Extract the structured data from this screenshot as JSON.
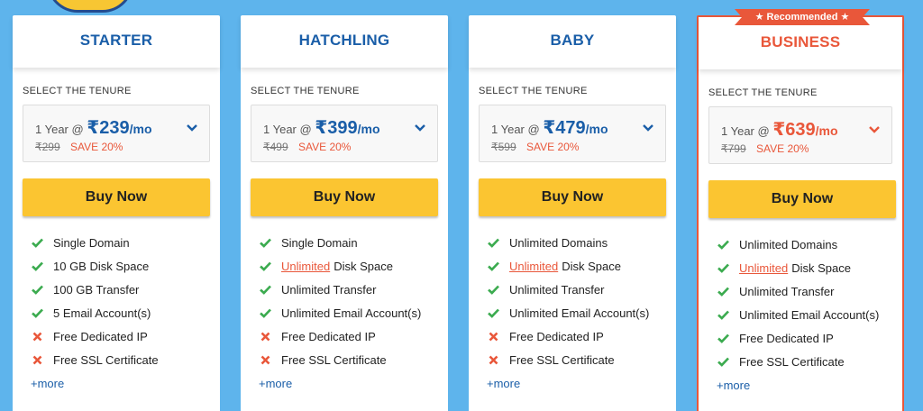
{
  "colors": {
    "background": "#5eb4ec",
    "brand_blue": "#1a5ea8",
    "accent_orange": "#e9573a",
    "button_yellow": "#fbc531",
    "check_green": "#3bab4f"
  },
  "recommended_label": "★ Recommended ★",
  "plans": [
    {
      "name": "STARTER",
      "tenure_label": "SELECT THE TENURE",
      "duration": "1 Year @",
      "price": "₹239",
      "per": "/mo",
      "old_price": "₹299",
      "save": "SAVE 20%",
      "button": "Buy Now",
      "features": [
        {
          "icon": "check-icon",
          "highlight": "",
          "text": "Single Domain"
        },
        {
          "icon": "check-icon",
          "highlight": "",
          "text": "10 GB Disk Space"
        },
        {
          "icon": "check-icon",
          "highlight": "",
          "text": "100 GB Transfer"
        },
        {
          "icon": "check-icon",
          "highlight": "",
          "text": "5 Email Account(s)"
        },
        {
          "icon": "cross-icon",
          "highlight": "",
          "text": "Free Dedicated IP"
        },
        {
          "icon": "cross-icon",
          "highlight": "",
          "text": "Free SSL Certificate"
        }
      ],
      "more": "+more"
    },
    {
      "name": "HATCHLING",
      "tenure_label": "SELECT THE TENURE",
      "duration": "1 Year @",
      "price": "₹399",
      "per": "/mo",
      "old_price": "₹499",
      "save": "SAVE 20%",
      "button": "Buy Now",
      "features": [
        {
          "icon": "check-icon",
          "highlight": "",
          "text": "Single Domain"
        },
        {
          "icon": "check-icon",
          "highlight": "Unlimited",
          "text": "Disk Space"
        },
        {
          "icon": "check-icon",
          "highlight": "",
          "text": "Unlimited Transfer"
        },
        {
          "icon": "check-icon",
          "highlight": "",
          "text": "Unlimited Email Account(s)"
        },
        {
          "icon": "cross-icon",
          "highlight": "",
          "text": "Free Dedicated IP"
        },
        {
          "icon": "cross-icon",
          "highlight": "",
          "text": "Free SSL Certificate"
        }
      ],
      "more": "+more"
    },
    {
      "name": "BABY",
      "tenure_label": "SELECT THE TENURE",
      "duration": "1 Year @",
      "price": "₹479",
      "per": "/mo",
      "old_price": "₹599",
      "save": "SAVE 20%",
      "button": "Buy Now",
      "features": [
        {
          "icon": "check-icon",
          "highlight": "",
          "text": "Unlimited Domains"
        },
        {
          "icon": "check-icon",
          "highlight": "Unlimited",
          "text": "Disk Space"
        },
        {
          "icon": "check-icon",
          "highlight": "",
          "text": "Unlimited Transfer"
        },
        {
          "icon": "check-icon",
          "highlight": "",
          "text": "Unlimited Email Account(s)"
        },
        {
          "icon": "cross-icon",
          "highlight": "",
          "text": "Free Dedicated IP"
        },
        {
          "icon": "cross-icon",
          "highlight": "",
          "text": "Free SSL Certificate"
        }
      ],
      "more": "+more"
    },
    {
      "name": "BUSINESS",
      "tenure_label": "SELECT THE TENURE",
      "duration": "1 Year @",
      "price": "₹639",
      "per": "/mo",
      "old_price": "₹799",
      "save": "SAVE 20%",
      "button": "Buy Now",
      "features": [
        {
          "icon": "check-icon",
          "highlight": "",
          "text": "Unlimited Domains"
        },
        {
          "icon": "check-icon",
          "highlight": "Unlimited",
          "text": "Disk Space"
        },
        {
          "icon": "check-icon",
          "highlight": "",
          "text": "Unlimited Transfer"
        },
        {
          "icon": "check-icon",
          "highlight": "",
          "text": "Unlimited Email Account(s)"
        },
        {
          "icon": "check-icon",
          "highlight": "",
          "text": "Free Dedicated IP"
        },
        {
          "icon": "check-icon",
          "highlight": "",
          "text": "Free SSL Certificate"
        }
      ],
      "more": "+more"
    }
  ]
}
